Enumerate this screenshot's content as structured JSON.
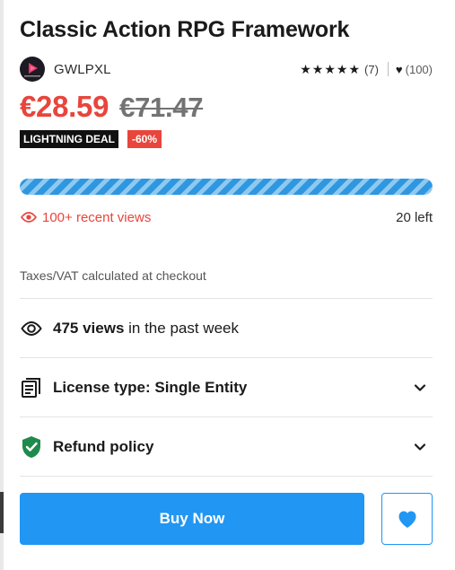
{
  "product": {
    "title": "Classic Action RPG Framework",
    "seller": "GWLPXL",
    "avatar_text": "GWLPXL",
    "rating_stars": 5,
    "rating_count": "(7)",
    "favorites_count": "(100)"
  },
  "pricing": {
    "price": "€28.59",
    "original_price": "€71.47",
    "deal_label": "LIGHTNING DEAL",
    "discount_label": "-60%"
  },
  "stock": {
    "progress_percent": 100,
    "recent_views": "100+ recent views",
    "left_label": "20 left"
  },
  "tax_note": "Taxes/VAT calculated at checkout",
  "weekly_views": {
    "count": "475 views",
    "suffix": " in the past week"
  },
  "accordions": [
    {
      "label": "License type: Single Entity",
      "icon": "license-icon"
    },
    {
      "label": "Refund policy",
      "icon": "shield-check-icon"
    }
  ],
  "actions": {
    "buy_label": "Buy Now",
    "wishlist_icon": "heart-icon"
  },
  "colors": {
    "accent": "#2196f3",
    "sale": "#e8453c",
    "shield": "#1f8a4c"
  }
}
